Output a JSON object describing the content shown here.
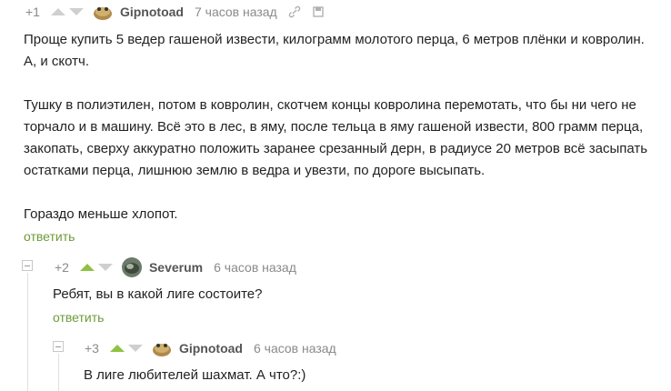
{
  "comment1": {
    "rating": "+1",
    "author": "Gipnotoad",
    "time": "7 часов назад",
    "icons": [
      "link-icon",
      "bookmark-icon"
    ],
    "paragraphs": [
      "Проще купить 5 ведер гашеной извести, килограмм молотого перца, 6 метров плёнки и ковролин. А, и скотч.",
      "Тушку в полиэтилен, потом в ковролин, скотчем концы ковролина перемотать, что бы ни чего не торчало и в машину. Всё это в лес, в яму, после тельца в яму гашеной извести, 800 грамм перца, закопать, сверху аккуратно положить заранее срезанный дерн, в радиусе 20 метров всё засыпать остатками перца, лишнюю землю в ведра и увезти, по дороге высыпать.",
      "Гораздо меньше хлопот."
    ],
    "reply_label": "ответить"
  },
  "comment2": {
    "rating": "+2",
    "author": "Severum",
    "time": "6 часов назад",
    "text": "Ребят, вы в какой лиге состоите?",
    "reply_label": "ответить"
  },
  "comment3": {
    "rating": "+3",
    "author": "Gipnotoad",
    "time": "6 часов назад",
    "text": "В лиге любителей шахмат. А что?:)"
  },
  "colors": {
    "accent": "#6e9b3a",
    "upvote_active": "#8fc144",
    "muted": "#8a8a8a"
  }
}
